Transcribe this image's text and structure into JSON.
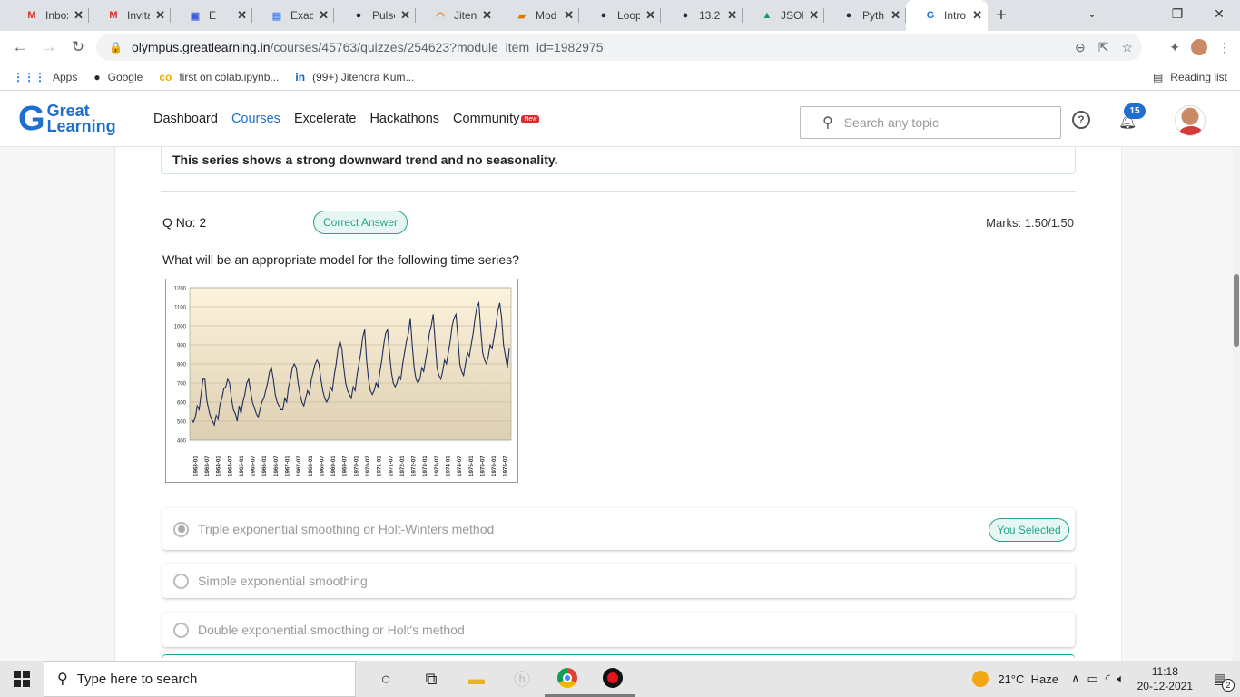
{
  "browser": {
    "tabs": [
      {
        "label": "Inbox",
        "icon": "gmail-icon",
        "fav": "M",
        "color": "#d93025"
      },
      {
        "label": "Invita",
        "icon": "gmail-icon",
        "fav": "M",
        "color": "#d93025"
      },
      {
        "label": "E",
        "icon": "app-icon",
        "fav": "▣",
        "color": "#3c5cde"
      },
      {
        "label": "Exact",
        "icon": "docs-icon",
        "fav": "▤",
        "color": "#4285f4"
      },
      {
        "label": "Pulse",
        "icon": "github-icon",
        "fav": "●",
        "color": "#24292e"
      },
      {
        "label": "Jiten",
        "icon": "jupyter-icon",
        "fav": "◠",
        "color": "#f37726"
      },
      {
        "label": "Mod",
        "icon": "notebook-icon",
        "fav": "▰",
        "color": "#e37400"
      },
      {
        "label": "Loop",
        "icon": "github-icon",
        "fav": "●",
        "color": "#24292e"
      },
      {
        "label": "13.2",
        "icon": "github-icon",
        "fav": "●",
        "color": "#24292e"
      },
      {
        "label": "JSON",
        "icon": "drive-icon",
        "fav": "▲",
        "color": "#0f9d58"
      },
      {
        "label": "Pyth",
        "icon": "github-icon",
        "fav": "●",
        "color": "#24292e"
      },
      {
        "label": "Intro",
        "icon": "greatlearning-icon",
        "fav": "G",
        "color": "#1f6fd1"
      }
    ],
    "url_domain": "olympus.greatlearning.in",
    "url_path": "/courses/45763/quizzes/254623?module_item_id=1982975",
    "bookmarks": [
      {
        "label": "Apps",
        "icon": "apps-grid-icon",
        "glyph": "⋮⋮⋮",
        "color": "#1a73e8"
      },
      {
        "label": "Google",
        "icon": "github-icon",
        "glyph": "●",
        "color": "#24292e"
      },
      {
        "label": "first on colab.ipynb...",
        "icon": "colab-icon",
        "glyph": "co",
        "color": "#f9ab00"
      },
      {
        "label": "(99+) Jitendra Kum...",
        "icon": "linkedin-icon",
        "glyph": "in",
        "color": "#0a66c2"
      }
    ],
    "reading_list": "Reading list"
  },
  "site": {
    "logo_line1": "Great",
    "logo_line2": "Learning",
    "nav": [
      "Dashboard",
      "Courses",
      "Excelerate",
      "Hackathons",
      "Community"
    ],
    "nav_active": "Courses",
    "new_badge": "New",
    "search_placeholder": "Search any topic",
    "notification_count": "15"
  },
  "quiz": {
    "prev_answer_text": "This series shows a strong downward trend and no seasonality.",
    "qno_label": "Q No: 2",
    "status_badge": "Correct Answer",
    "marks": "Marks: 1.50/1.50",
    "question": "What will be an appropriate model for the following time series?",
    "options": [
      {
        "text": "Triple exponential smoothing or Holt-Winters method",
        "selected": true,
        "badge": "You Selected"
      },
      {
        "text": "Simple exponential smoothing",
        "selected": false
      },
      {
        "text": "Double exponential smoothing or Holt's method",
        "selected": false
      }
    ]
  },
  "chart_data": {
    "type": "line",
    "title": "",
    "xlabel": "",
    "ylabel": "",
    "ylim": [
      400,
      1200
    ],
    "yticks": [
      400,
      500,
      600,
      700,
      800,
      900,
      1000,
      1100,
      1200
    ],
    "xticks": [
      "1963-01",
      "1963-07",
      "1964-01",
      "1964-07",
      "1965-01",
      "1965-07",
      "1966-01",
      "1966-07",
      "1967-01",
      "1967-07",
      "1968-01",
      "1968-07",
      "1969-01",
      "1969-07",
      "1970-01",
      "1970-07",
      "1971-01",
      "1971-07",
      "1972-01",
      "1972-07",
      "1973-01",
      "1973-07",
      "1974-01",
      "1974-07",
      "1975-01",
      "1975-07",
      "1976-01",
      "1976-07"
    ],
    "grid": true,
    "series": [
      {
        "values": [
          510,
          495,
          520,
          580,
          560,
          640,
          720,
          720,
          610,
          560,
          520,
          500,
          480,
          530,
          510,
          590,
          620,
          670,
          680,
          720,
          700,
          620,
          560,
          540,
          500,
          580,
          540,
          600,
          640,
          700,
          720,
          660,
          600,
          570,
          540,
          520,
          560,
          600,
          620,
          660,
          700,
          760,
          780,
          720,
          640,
          600,
          580,
          560,
          560,
          620,
          600,
          680,
          720,
          780,
          800,
          780,
          700,
          640,
          600,
          580,
          620,
          660,
          640,
          720,
          760,
          800,
          820,
          800,
          720,
          660,
          620,
          600,
          620,
          680,
          660,
          740,
          800,
          880,
          920,
          880,
          780,
          700,
          660,
          640,
          620,
          680,
          660,
          740,
          800,
          860,
          940,
          980,
          820,
          720,
          660,
          640,
          660,
          700,
          680,
          760,
          820,
          900,
          960,
          980,
          860,
          760,
          700,
          680,
          700,
          740,
          720,
          800,
          860,
          920,
          960,
          1040,
          900,
          780,
          720,
          700,
          720,
          780,
          760,
          820,
          880,
          960,
          1000,
          1060,
          920,
          780,
          740,
          720,
          760,
          820,
          800,
          860,
          920,
          1000,
          1040,
          1060,
          940,
          800,
          760,
          740,
          800,
          860,
          840,
          900,
          960,
          1040,
          1100,
          1120,
          980,
          860,
          820,
          800,
          840,
          900,
          880,
          940,
          1000,
          1080,
          1120,
          1040,
          900,
          840,
          780,
          880
        ]
      }
    ]
  },
  "taskbar": {
    "search_placeholder": "Type here to search",
    "weather": "21°C  Haze",
    "time": "11:18",
    "date": "20-12-2021",
    "notification_count": "2"
  }
}
